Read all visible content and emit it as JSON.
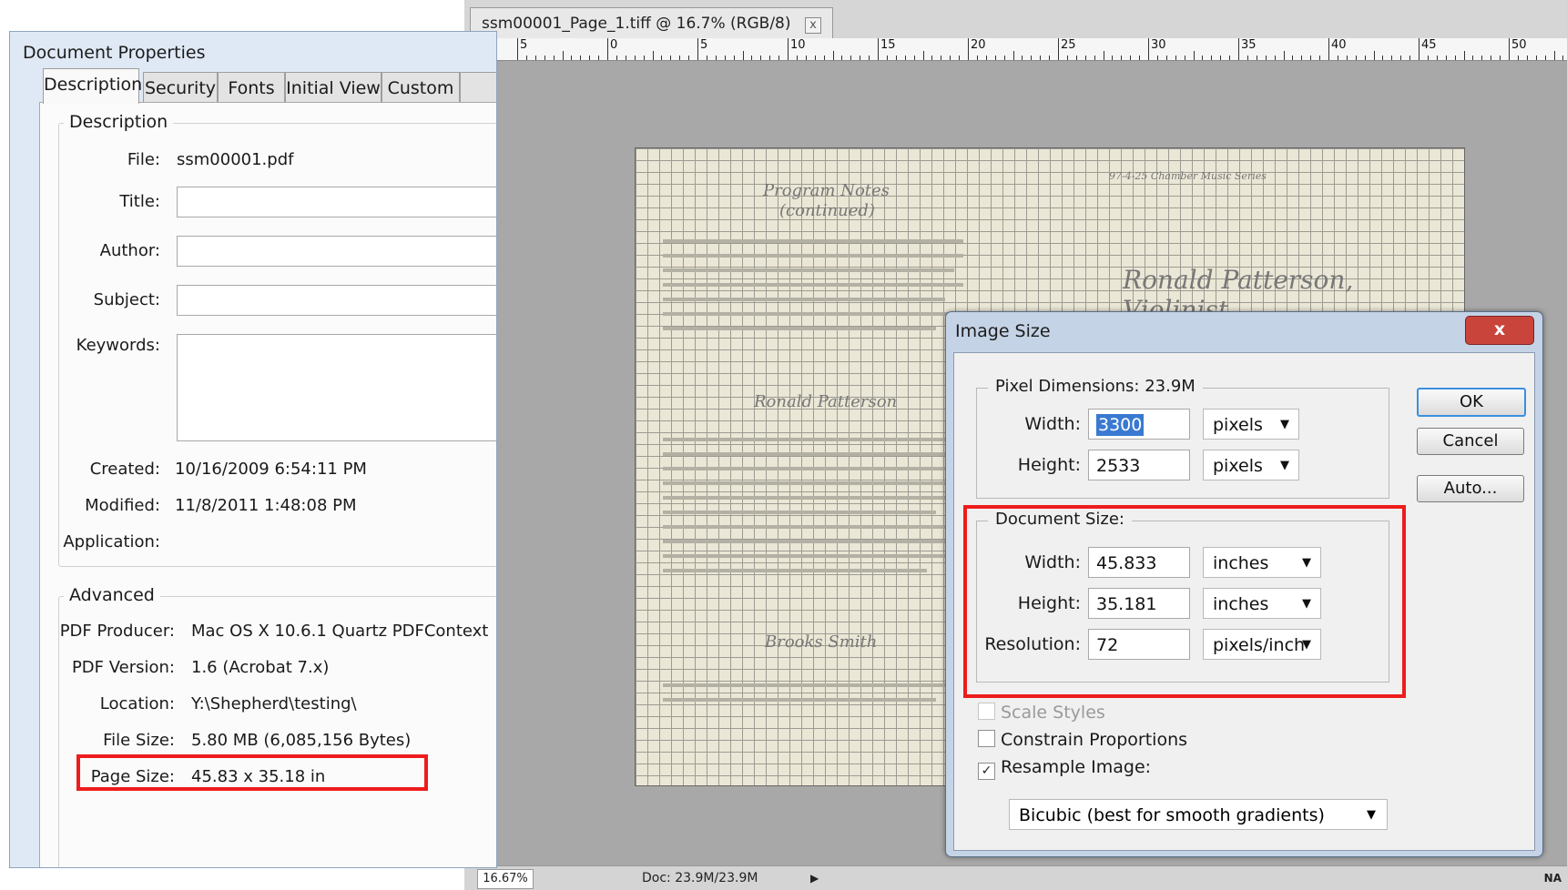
{
  "photoshop": {
    "tab_title": "ssm00001_Page_1.tiff @ 16.7% (RGB/8)",
    "tab_close": "x",
    "ruler_labels": [
      "5",
      "0",
      "5",
      "10",
      "15",
      "20",
      "25",
      "30",
      "35",
      "40",
      "45",
      "50"
    ],
    "status_zoom": "16.67%",
    "status_doc": "Doc: 23.9M/23.9M",
    "status_right": "NA"
  },
  "document_image": {
    "heading1": "Program Notes",
    "heading1b": "(continued)",
    "header_right": "97-4-25 Chamber Music Series",
    "title": "Ronald Patterson, Violinist",
    "name1": "Ronald Patterson",
    "name2": "Brooks Smith"
  },
  "image_size": {
    "title": "Image Size",
    "close": "x",
    "pixel_dimensions_label": "Pixel Dimensions:",
    "pixel_dimensions_value": "23.9M",
    "width_label": "Width:",
    "height_label": "Height:",
    "pixel_width": "3300",
    "pixel_height": "2533",
    "pixel_unit": "pixels",
    "document_size_label": "Document Size:",
    "doc_width": "45.833",
    "doc_height": "35.181",
    "doc_unit": "inches",
    "resolution_label": "Resolution:",
    "resolution": "72",
    "resolution_unit": "pixels/inch",
    "ok": "OK",
    "cancel": "Cancel",
    "auto": "Auto...",
    "scale_styles": "Scale Styles",
    "constrain": "Constrain Proportions",
    "resample": "Resample Image:",
    "resample_method": "Bicubic (best for smooth gradients)",
    "checkmark": "✓",
    "dropdown_arrow": "▼"
  },
  "doc_props": {
    "title": "Document Properties",
    "tabs": [
      "Description",
      "Security",
      "Fonts",
      "Initial View",
      "Custom"
    ],
    "description_legend": "Description",
    "file_label": "File:",
    "file_value": "ssm00001.pdf",
    "title_label": "Title:",
    "author_label": "Author:",
    "subject_label": "Subject:",
    "keywords_label": "Keywords:",
    "created_label": "Created:",
    "created_value": "10/16/2009 6:54:11 PM",
    "modified_label": "Modified:",
    "modified_value": "11/8/2011 1:48:08 PM",
    "application_label": "Application:",
    "advanced_legend": "Advanced",
    "producer_label": "PDF Producer:",
    "producer_value": "Mac OS X 10.6.1 Quartz PDFContext",
    "version_label": "PDF Version:",
    "version_value": "1.6 (Acrobat 7.x)",
    "location_label": "Location:",
    "location_value": "Y:\\Shepherd\\testing\\",
    "filesize_label": "File Size:",
    "filesize_value": "5.80 MB (6,085,156 Bytes)",
    "pagesize_label": "Page Size:",
    "pagesize_value": "45.83 x 35.18 in"
  },
  "colors": {
    "highlight_red": "#ee1c1c",
    "selection_blue": "#3a79d1",
    "close_red": "#c9443a"
  }
}
